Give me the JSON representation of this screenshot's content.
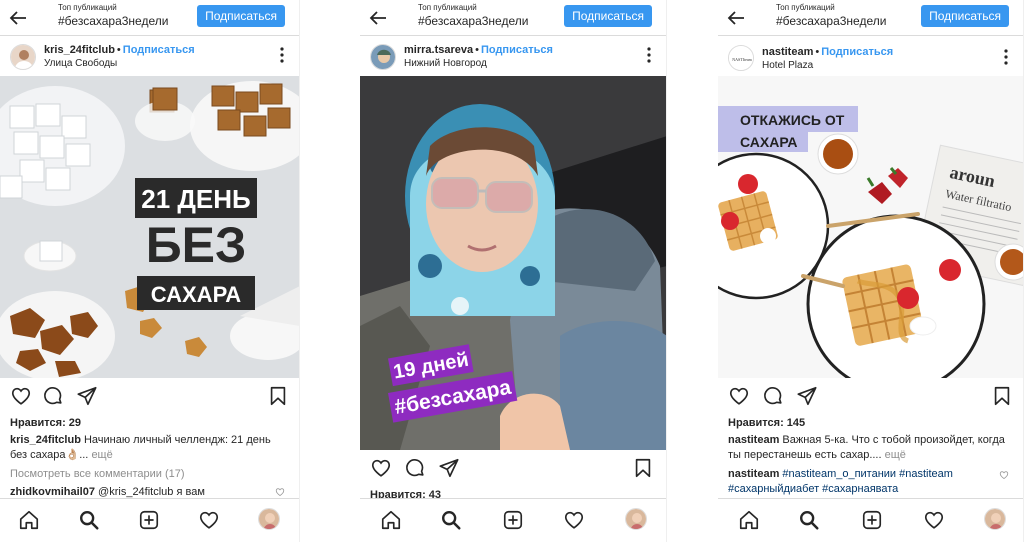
{
  "top_posts_label": "Топ публикаций",
  "hashtag": "#безсахара3недели",
  "subscribe_button": "Подписаться",
  "follow_link": "Подписаться",
  "dot": "•",
  "posts": [
    {
      "username": "kris_24fitclub",
      "location": "Улица Свободы",
      "overlay": {
        "line1": "21 ДЕНЬ",
        "line2": "БЕЗ",
        "line3": "САХАРА"
      },
      "likes": "Нравится: 29",
      "caption_user": "kris_24fitclub",
      "caption_text": "Начинаю личный челлендж: 21 день без сахара👌🏼...",
      "caption_more": "ещё",
      "comments_link": "Посмотреть все комментарии (17)",
      "comment_user": "zhidkovmihail07",
      "comment_text": "@kris_24fitclub я вам"
    },
    {
      "username": "mirra.tsareva",
      "location": "Нижний Новгород",
      "overlay": {
        "line1": "19 дней",
        "line2": "#безсахара"
      },
      "likes": "Нравится: 43"
    },
    {
      "username": "nastiteam",
      "location": "Hotel Plaza",
      "avatar_text": "NASTIteam",
      "overlay": {
        "line1": "ОТКАЖИСЬ ОТ",
        "line2": "САХАРА"
      },
      "newspaper_text": {
        "line1": "aroun",
        "line2": "Water filtratio"
      },
      "likes": "Нравится: 145",
      "caption_user": "nastiteam",
      "caption_text": "Важная 5-ка. Что с тобой произойдет, когда ты перестанешь есть сахар....",
      "caption_more": "ещё",
      "tags_user": "nastiteam",
      "tags_text": "#nastiteam_о_питании #nastiteam #сахарныйдиабет #сахарнаявата"
    }
  ],
  "colors": {
    "accent": "#3897f0",
    "purple": "#8e2bc0",
    "text": "#262626",
    "muted": "#8e8e8e"
  },
  "icons": [
    "back-arrow-icon",
    "more-vertical-icon",
    "heart-icon",
    "comment-icon",
    "share-icon",
    "bookmark-icon",
    "home-icon",
    "search-icon",
    "add-icon",
    "activity-heart-icon",
    "profile-avatar"
  ]
}
